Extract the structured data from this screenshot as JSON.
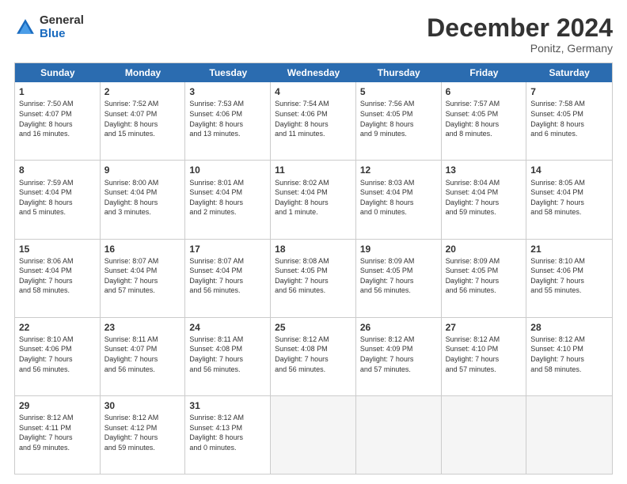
{
  "logo": {
    "general": "General",
    "blue": "Blue"
  },
  "title": "December 2024",
  "subtitle": "Ponitz, Germany",
  "header_days": [
    "Sunday",
    "Monday",
    "Tuesday",
    "Wednesday",
    "Thursday",
    "Friday",
    "Saturday"
  ],
  "weeks": [
    [
      {
        "day": "1",
        "lines": [
          "Sunrise: 7:50 AM",
          "Sunset: 4:07 PM",
          "Daylight: 8 hours",
          "and 16 minutes."
        ]
      },
      {
        "day": "2",
        "lines": [
          "Sunrise: 7:52 AM",
          "Sunset: 4:07 PM",
          "Daylight: 8 hours",
          "and 15 minutes."
        ]
      },
      {
        "day": "3",
        "lines": [
          "Sunrise: 7:53 AM",
          "Sunset: 4:06 PM",
          "Daylight: 8 hours",
          "and 13 minutes."
        ]
      },
      {
        "day": "4",
        "lines": [
          "Sunrise: 7:54 AM",
          "Sunset: 4:06 PM",
          "Daylight: 8 hours",
          "and 11 minutes."
        ]
      },
      {
        "day": "5",
        "lines": [
          "Sunrise: 7:56 AM",
          "Sunset: 4:05 PM",
          "Daylight: 8 hours",
          "and 9 minutes."
        ]
      },
      {
        "day": "6",
        "lines": [
          "Sunrise: 7:57 AM",
          "Sunset: 4:05 PM",
          "Daylight: 8 hours",
          "and 8 minutes."
        ]
      },
      {
        "day": "7",
        "lines": [
          "Sunrise: 7:58 AM",
          "Sunset: 4:05 PM",
          "Daylight: 8 hours",
          "and 6 minutes."
        ]
      }
    ],
    [
      {
        "day": "8",
        "lines": [
          "Sunrise: 7:59 AM",
          "Sunset: 4:04 PM",
          "Daylight: 8 hours",
          "and 5 minutes."
        ]
      },
      {
        "day": "9",
        "lines": [
          "Sunrise: 8:00 AM",
          "Sunset: 4:04 PM",
          "Daylight: 8 hours",
          "and 3 minutes."
        ]
      },
      {
        "day": "10",
        "lines": [
          "Sunrise: 8:01 AM",
          "Sunset: 4:04 PM",
          "Daylight: 8 hours",
          "and 2 minutes."
        ]
      },
      {
        "day": "11",
        "lines": [
          "Sunrise: 8:02 AM",
          "Sunset: 4:04 PM",
          "Daylight: 8 hours",
          "and 1 minute."
        ]
      },
      {
        "day": "12",
        "lines": [
          "Sunrise: 8:03 AM",
          "Sunset: 4:04 PM",
          "Daylight: 8 hours",
          "and 0 minutes."
        ]
      },
      {
        "day": "13",
        "lines": [
          "Sunrise: 8:04 AM",
          "Sunset: 4:04 PM",
          "Daylight: 7 hours",
          "and 59 minutes."
        ]
      },
      {
        "day": "14",
        "lines": [
          "Sunrise: 8:05 AM",
          "Sunset: 4:04 PM",
          "Daylight: 7 hours",
          "and 58 minutes."
        ]
      }
    ],
    [
      {
        "day": "15",
        "lines": [
          "Sunrise: 8:06 AM",
          "Sunset: 4:04 PM",
          "Daylight: 7 hours",
          "and 58 minutes."
        ]
      },
      {
        "day": "16",
        "lines": [
          "Sunrise: 8:07 AM",
          "Sunset: 4:04 PM",
          "Daylight: 7 hours",
          "and 57 minutes."
        ]
      },
      {
        "day": "17",
        "lines": [
          "Sunrise: 8:07 AM",
          "Sunset: 4:04 PM",
          "Daylight: 7 hours",
          "and 56 minutes."
        ]
      },
      {
        "day": "18",
        "lines": [
          "Sunrise: 8:08 AM",
          "Sunset: 4:05 PM",
          "Daylight: 7 hours",
          "and 56 minutes."
        ]
      },
      {
        "day": "19",
        "lines": [
          "Sunrise: 8:09 AM",
          "Sunset: 4:05 PM",
          "Daylight: 7 hours",
          "and 56 minutes."
        ]
      },
      {
        "day": "20",
        "lines": [
          "Sunrise: 8:09 AM",
          "Sunset: 4:05 PM",
          "Daylight: 7 hours",
          "and 56 minutes."
        ]
      },
      {
        "day": "21",
        "lines": [
          "Sunrise: 8:10 AM",
          "Sunset: 4:06 PM",
          "Daylight: 7 hours",
          "and 55 minutes."
        ]
      }
    ],
    [
      {
        "day": "22",
        "lines": [
          "Sunrise: 8:10 AM",
          "Sunset: 4:06 PM",
          "Daylight: 7 hours",
          "and 56 minutes."
        ]
      },
      {
        "day": "23",
        "lines": [
          "Sunrise: 8:11 AM",
          "Sunset: 4:07 PM",
          "Daylight: 7 hours",
          "and 56 minutes."
        ]
      },
      {
        "day": "24",
        "lines": [
          "Sunrise: 8:11 AM",
          "Sunset: 4:08 PM",
          "Daylight: 7 hours",
          "and 56 minutes."
        ]
      },
      {
        "day": "25",
        "lines": [
          "Sunrise: 8:12 AM",
          "Sunset: 4:08 PM",
          "Daylight: 7 hours",
          "and 56 minutes."
        ]
      },
      {
        "day": "26",
        "lines": [
          "Sunrise: 8:12 AM",
          "Sunset: 4:09 PM",
          "Daylight: 7 hours",
          "and 57 minutes."
        ]
      },
      {
        "day": "27",
        "lines": [
          "Sunrise: 8:12 AM",
          "Sunset: 4:10 PM",
          "Daylight: 7 hours",
          "and 57 minutes."
        ]
      },
      {
        "day": "28",
        "lines": [
          "Sunrise: 8:12 AM",
          "Sunset: 4:10 PM",
          "Daylight: 7 hours",
          "and 58 minutes."
        ]
      }
    ],
    [
      {
        "day": "29",
        "lines": [
          "Sunrise: 8:12 AM",
          "Sunset: 4:11 PM",
          "Daylight: 7 hours",
          "and 59 minutes."
        ]
      },
      {
        "day": "30",
        "lines": [
          "Sunrise: 8:12 AM",
          "Sunset: 4:12 PM",
          "Daylight: 7 hours",
          "and 59 minutes."
        ]
      },
      {
        "day": "31",
        "lines": [
          "Sunrise: 8:12 AM",
          "Sunset: 4:13 PM",
          "Daylight: 8 hours",
          "and 0 minutes."
        ]
      },
      null,
      null,
      null,
      null
    ]
  ]
}
